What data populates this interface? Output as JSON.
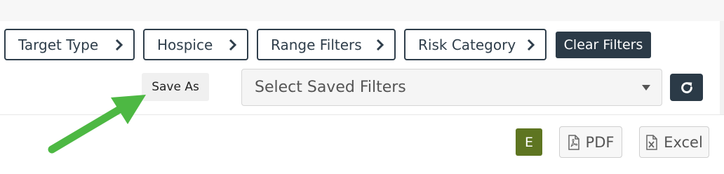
{
  "filters": [
    {
      "label": "Target Type"
    },
    {
      "label": "Hospice"
    },
    {
      "label": "Range Filters"
    },
    {
      "label": "Risk Category"
    }
  ],
  "clear_filters_label": "Clear Filters",
  "save_as_label": "Save As",
  "saved_filters": {
    "selected": "Select Saved Filters"
  },
  "refresh_icon": "refresh-icon",
  "export": {
    "e_label": "E",
    "pdf_label": "PDF",
    "excel_label": "Excel"
  },
  "colors": {
    "dark": "#2b3a47",
    "green_badge": "#5e7521",
    "arrow": "#4db843"
  }
}
